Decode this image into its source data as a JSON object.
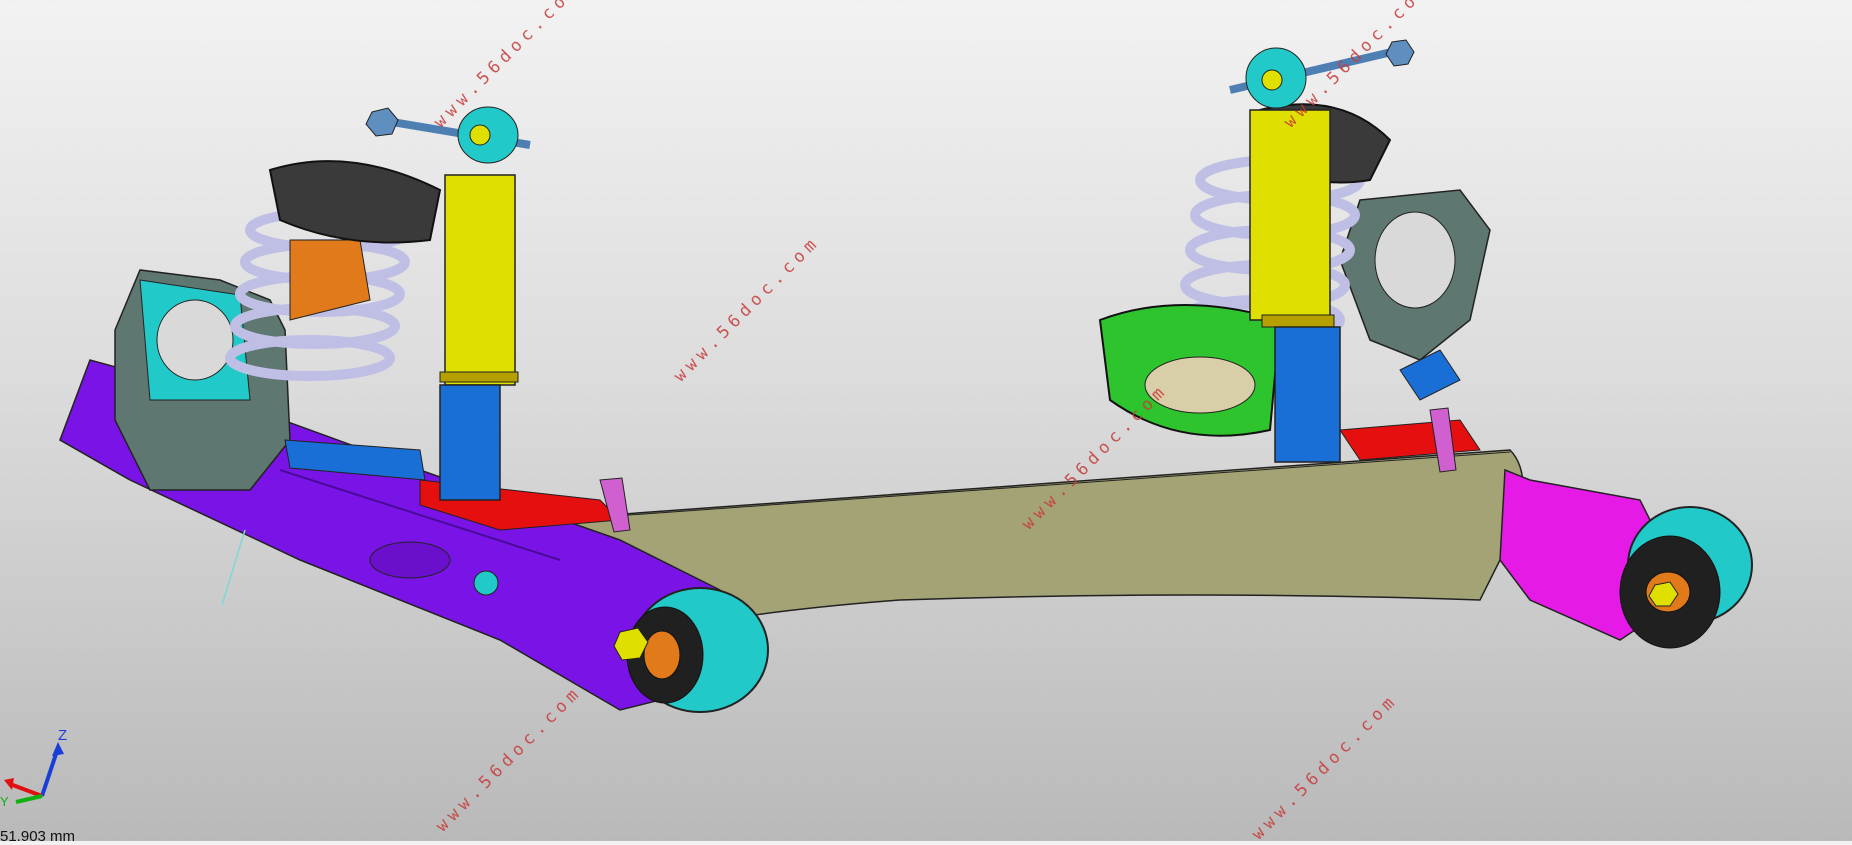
{
  "viewport": {
    "watermark_text": "www.56doc.com",
    "scale_readout": "51.903 mm",
    "axis_labels": {
      "z": "Z",
      "y": "Y"
    }
  },
  "colors": {
    "trailing_arm": "#7a14e6",
    "crossbeam": "#a3a376",
    "spring": "#bfbfe6",
    "damper_body": "#e0e000",
    "damper_rod": "#1a6fd6",
    "knuckle_plate": "#5e7770",
    "bushing": "#22c9c9",
    "watermark": "#c83a3a"
  }
}
